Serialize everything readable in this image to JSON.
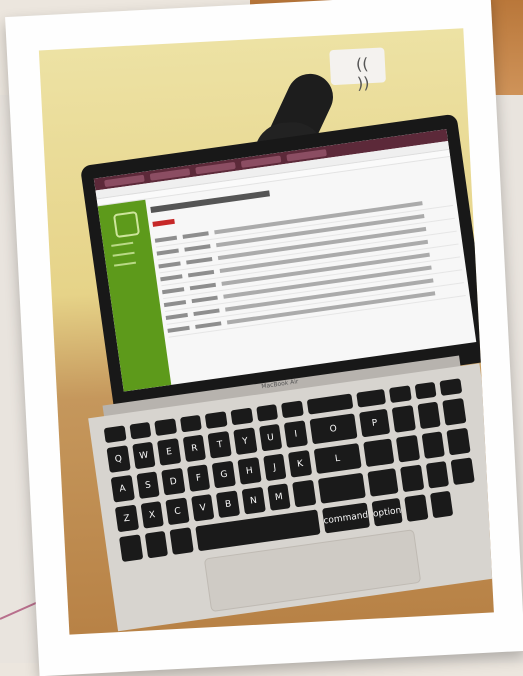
{
  "laptop": {
    "hinge_label": "MacBook Air",
    "keyboard": {
      "keys": [
        "command",
        "option",
        "command",
        "option",
        "Q",
        "W",
        "E",
        "R",
        "T",
        "Y",
        "U",
        "I",
        "O",
        "P",
        "A",
        "S",
        "D",
        "F",
        "G",
        "H",
        "J",
        "K",
        "L",
        "Z",
        "X",
        "C",
        "V",
        "B",
        "N",
        "M"
      ]
    }
  }
}
